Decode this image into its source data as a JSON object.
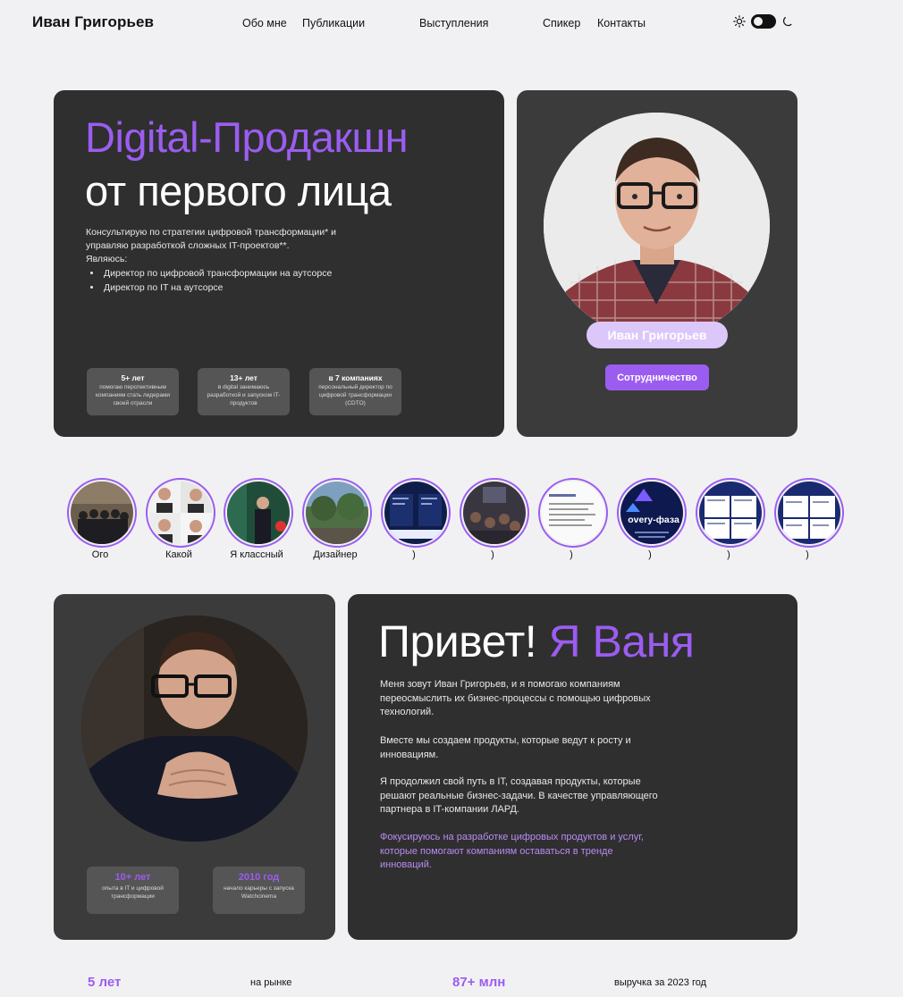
{
  "header": {
    "brand": "Иван Григорьев",
    "nav": [
      "Обо мне",
      "Публикации",
      "Выступления",
      "Спикер",
      "Контакты"
    ]
  },
  "hero": {
    "title_accent": "Digital-Продакшн",
    "title_main": "от первого лица",
    "intro": "Консультирую по стратегии цифровой трансформации* и управляю разработкой сложных IT-проектов**.",
    "role_label": "Являюсь:",
    "roles": [
      "Директор по цифровой трансформации на аутсорсе",
      "Директор по IT на аутсорсе"
    ],
    "stats": [
      {
        "title": "5+ лет",
        "desc": "помогаю перспективным компаниям стать лидерами своей отрасли"
      },
      {
        "title": "13+ лет",
        "desc": "в digital занимаюсь разработкой и запуском IT-продуктов"
      },
      {
        "title": "в 7 компаниях",
        "desc": "персональный директор по цифровой трансформации (CDTO)"
      }
    ]
  },
  "profile": {
    "name": "Иван Григорьев",
    "cta": "Сотрудничество"
  },
  "stories": [
    {
      "label": "Ого"
    },
    {
      "label": "Какой"
    },
    {
      "label": "Я классный"
    },
    {
      "label": "Дизайнер"
    },
    {
      "label": ")"
    },
    {
      "label": ")"
    },
    {
      "label": ")"
    },
    {
      "label": ")",
      "overlay": "overy-фаза"
    },
    {
      "label": ")"
    },
    {
      "label": ")"
    }
  ],
  "about": {
    "greeting": "Привет!",
    "greeting_accent": "Я Ваня",
    "paragraphs": [
      "Меня зовут Иван Григорьев, и я помогаю компаниям переосмыслить их бизнес-процессы с помощью цифровых технологий.",
      "Вместе мы создаем продукты, которые ведут к росту и инновациям.",
      "Я продолжил свой путь в IT, создавая продукты, которые решают реальные бизнес-задачи. В качестве управляющего партнера в IT-компании ЛАРД.",
      "Фокусируюсь на разработке цифровых продуктов и услуг, которые помогают компаниям оставаться в тренде инноваций."
    ],
    "stats": [
      {
        "title": "10+ лет",
        "desc": "опыта в IT и цифровой трансформации"
      },
      {
        "title": "2010 год",
        "desc": "начало карьеры с запуска Watchcinema"
      }
    ]
  },
  "bottom": {
    "items": [
      {
        "num": "5 лет",
        "label": "на рынке"
      },
      {
        "num": "87+ млн",
        "label": "выручка за 2023 год"
      }
    ]
  },
  "colors": {
    "accent": "#9b5df0",
    "card": "#2f2f2f",
    "background": "#f1f1f3"
  }
}
